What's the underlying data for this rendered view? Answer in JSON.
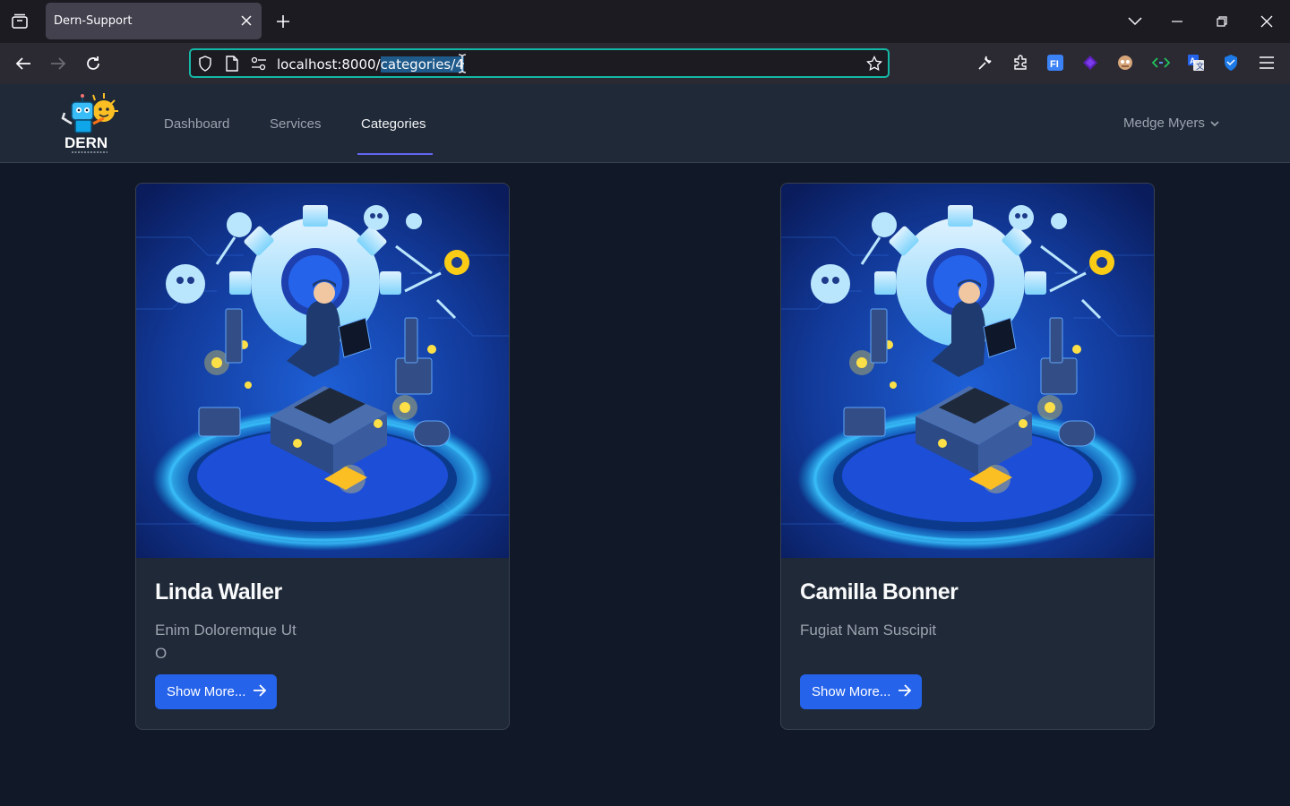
{
  "browser": {
    "tab_title": "Dern-Support",
    "url_host": "localhost:8000/",
    "url_path": "categories/4"
  },
  "app": {
    "logo_text": "DERN",
    "nav": [
      {
        "label": "Dashboard",
        "active": false
      },
      {
        "label": "Services",
        "active": false
      },
      {
        "label": "Categories",
        "active": true
      }
    ],
    "user_name": "Medge Myers"
  },
  "cards": [
    {
      "title": "Linda Waller",
      "desc_line1": "Enim Doloremque Ut",
      "desc_line2": "O",
      "button_label": "Show More..."
    },
    {
      "title": "Camilla Bonner",
      "desc_line1": "Fugiat Nam Suscipit",
      "desc_line2": "",
      "button_label": "Show More..."
    }
  ],
  "colors": {
    "page_bg": "#111827",
    "header_bg": "#1f2937",
    "accent": "#6366f1",
    "button": "#2563eb",
    "urlbar_focus": "#14b8a6"
  }
}
